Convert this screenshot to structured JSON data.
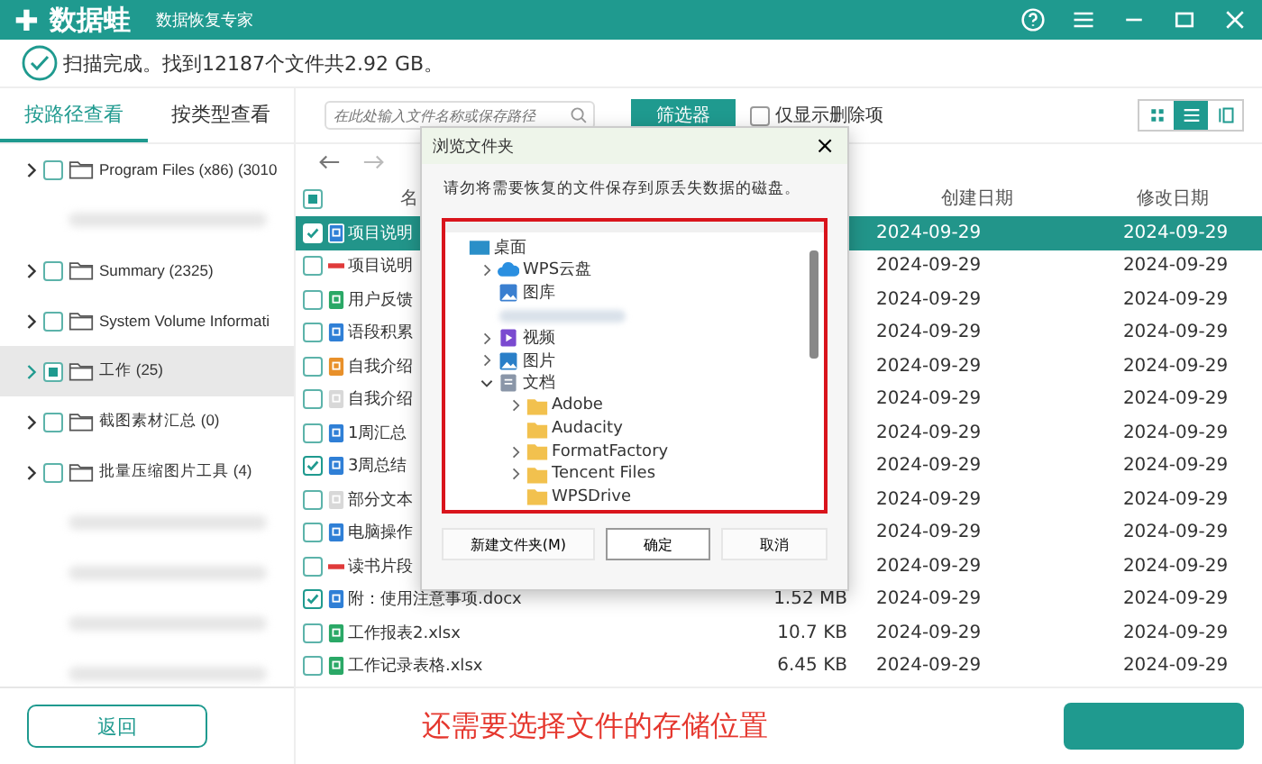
{
  "app": {
    "logo_mark": "✚",
    "name": "数据蛙",
    "subtitle": "数据恢复专家"
  },
  "status": "扫描完成。找到12187个文件共2.92 GB。",
  "view_tabs": [
    {
      "label": "按路径查看",
      "selected": true
    },
    {
      "label": "按类型查看",
      "selected": false
    }
  ],
  "search": {
    "placeholder": "在此处输入文件名称或保存路径"
  },
  "filter_button": "筛选器",
  "deleted_only": {
    "label": "仅显示删除项",
    "checked": false
  },
  "view_modes": [
    {
      "kind": "grid",
      "selected": false
    },
    {
      "kind": "list",
      "selected": true
    },
    {
      "kind": "detail",
      "selected": false
    }
  ],
  "tree": [
    {
      "kind": "folder",
      "label": "Program Files (x86) (3010",
      "checked": false,
      "partial": false,
      "selected": false
    },
    {
      "kind": "blurred"
    },
    {
      "kind": "folder",
      "label": "Summary (2325)",
      "checked": false,
      "partial": false,
      "selected": false
    },
    {
      "kind": "folder",
      "label": "System Volume Informati",
      "checked": false,
      "partial": false,
      "selected": false
    },
    {
      "kind": "folder",
      "label": "工作 (25)",
      "checked": false,
      "partial": true,
      "selected": true
    },
    {
      "kind": "folder",
      "label": "截图素材汇总 (0)",
      "checked": false,
      "partial": false,
      "selected": false
    },
    {
      "kind": "folder",
      "label": "批量压缩图片工具 (4)",
      "checked": false,
      "partial": false,
      "selected": false
    },
    {
      "kind": "blurred"
    },
    {
      "kind": "blurred"
    },
    {
      "kind": "blurred"
    },
    {
      "kind": "blurred"
    }
  ],
  "table": {
    "columns": [
      "名",
      "创建日期",
      "修改日期"
    ],
    "all_checked": false,
    "all_partial": true,
    "rows": [
      {
        "kind": "word",
        "name": "项目说明",
        "created": "2024-09-29",
        "modified": "2024-09-29",
        "checked": true,
        "selected": true
      },
      {
        "kind": "pdf",
        "name": "项目说明",
        "created": "2024-09-29",
        "modified": "2024-09-29",
        "checked": false,
        "selected": false
      },
      {
        "kind": "excel",
        "name": "用户反馈",
        "created": "2024-09-29",
        "modified": "2024-09-29",
        "checked": false,
        "selected": false
      },
      {
        "kind": "word",
        "name": "语段积累",
        "created": "2024-09-29",
        "modified": "2024-09-29",
        "checked": false,
        "selected": false
      },
      {
        "kind": "ppt",
        "name": "自我介绍",
        "created": "2024-09-29",
        "modified": "2024-09-29",
        "checked": false,
        "selected": false
      },
      {
        "kind": "text",
        "name": "自我介绍",
        "created": "2024-09-29",
        "modified": "2024-09-29",
        "checked": false,
        "selected": false
      },
      {
        "kind": "word",
        "name": "1周汇总",
        "created": "2024-09-29",
        "modified": "2024-09-29",
        "checked": false,
        "selected": false
      },
      {
        "kind": "word",
        "name": "3周总结",
        "created": "2024-09-29",
        "modified": "2024-09-29",
        "checked": true,
        "selected": false
      },
      {
        "kind": "text",
        "name": "部分文本",
        "created": "2024-09-29",
        "modified": "2024-09-29",
        "checked": false,
        "selected": false
      },
      {
        "kind": "word",
        "name": "电脑操作",
        "created": "2024-09-29",
        "modified": "2024-09-29",
        "checked": false,
        "selected": false
      },
      {
        "kind": "pdf",
        "name": "读书片段",
        "created": "2024-09-29",
        "modified": "2024-09-29",
        "checked": false,
        "selected": false
      },
      {
        "kind": "word",
        "name": "附：使用注意事项.docx",
        "size": "1.52 MB",
        "created": "2024-09-29",
        "modified": "2024-09-29",
        "checked": true,
        "selected": false
      },
      {
        "kind": "excel",
        "name": "工作报表2.xlsx",
        "size": "10.7 KB",
        "created": "2024-09-29",
        "modified": "2024-09-29",
        "checked": false,
        "selected": false
      },
      {
        "kind": "excel",
        "name": "工作记录表格.xlsx",
        "size": "6.45 KB",
        "created": "2024-09-29",
        "modified": "2024-09-29",
        "checked": false,
        "selected": false
      }
    ]
  },
  "back_button": "返回",
  "annotation": "还需要选择文件的存储位置",
  "dialog": {
    "title": "浏览文件夹",
    "close": "×",
    "message": "请勿将需要恢复的文件保存到原丢失数据的磁盘。",
    "tree": [
      {
        "kind": "desktop",
        "label": "桌面",
        "children": [
          {
            "kind": "cloud",
            "label": "WPS云盘",
            "expanded": false
          },
          {
            "kind": "gallery",
            "label": "图库"
          },
          {
            "kind": "blurred"
          },
          {
            "kind": "video",
            "label": "视频",
            "expanded": false
          },
          {
            "kind": "picture",
            "label": "图片",
            "expanded": false
          },
          {
            "kind": "document",
            "label": "文档",
            "expanded": true,
            "children": [
              {
                "kind": "folder",
                "label": "Adobe",
                "expanded": false
              },
              {
                "kind": "folder",
                "label": "Audacity"
              },
              {
                "kind": "folder",
                "label": "FormatFactory",
                "expanded": false
              },
              {
                "kind": "folder",
                "label": "Tencent Files",
                "expanded": false
              },
              {
                "kind": "folder",
                "label": "WPSDrive"
              }
            ]
          }
        ]
      }
    ],
    "buttons": [
      {
        "label": "新建文件夹(M)",
        "focused": false
      },
      {
        "label": "确定",
        "focused": true
      },
      {
        "label": "取消",
        "focused": false
      }
    ]
  }
}
